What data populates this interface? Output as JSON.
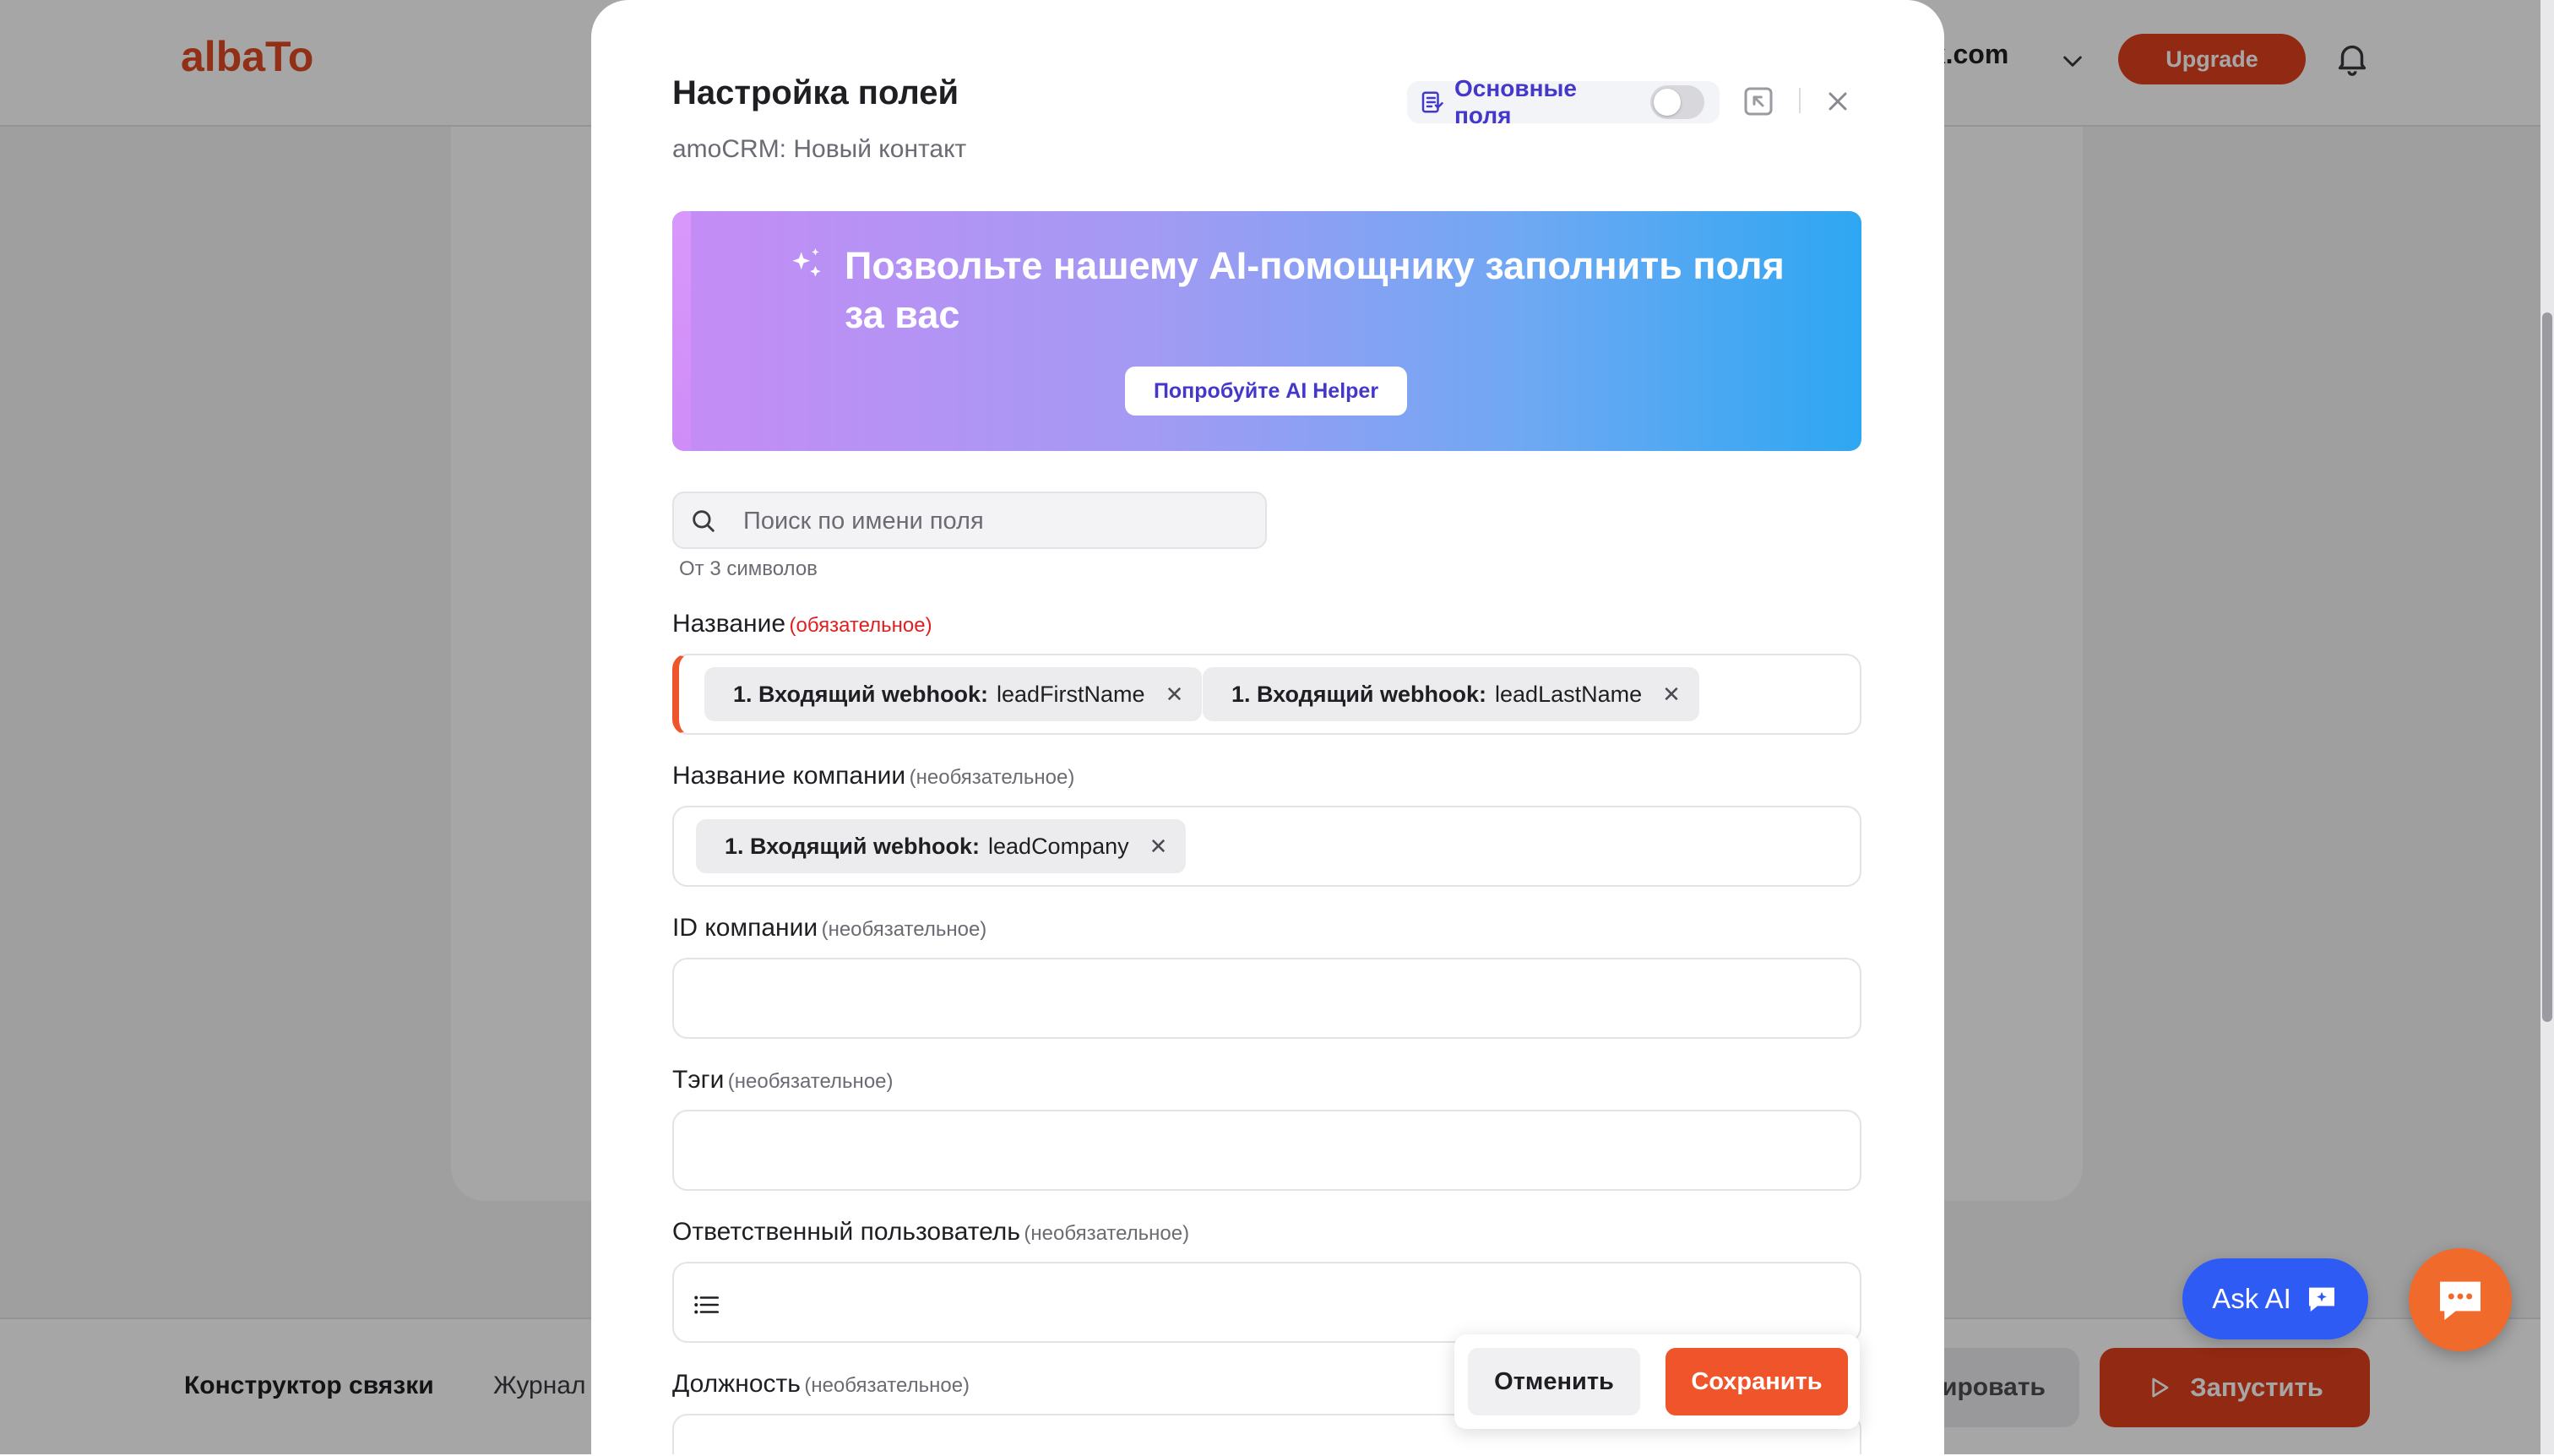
{
  "app": {
    "logo": "albaTo",
    "account": "vk.com",
    "upgrade_label": "Upgrade"
  },
  "bottom": {
    "tab_builder": "Конструктор связки",
    "tab_journal": "Журнал",
    "edit_label": "ировать",
    "run_label": "Запустить"
  },
  "floating": {
    "ask_ai": "Ask AI"
  },
  "modal": {
    "title": "Настройка полей",
    "subtitle": "amoCRM: Новый контакт",
    "basic_fields_label": "Основные поля",
    "basic_fields_enabled": false,
    "banner_text": "Позвольте нашему AI-помощнику заполнить поля за вас",
    "banner_button": "Попробуйте AI Helper",
    "search_placeholder": "Поиск по имени поля",
    "search_hint": "От 3 символов",
    "fields": [
      {
        "label": "Название",
        "tag": "(обязательное)",
        "chips": [
          {
            "source": "1. Входящий webhook:",
            "value": "leadFirstName"
          },
          {
            "source": "1. Входящий webhook:",
            "value": "leadLastName"
          }
        ]
      },
      {
        "label": "Название компании",
        "tag": "(необязательное)",
        "chips": [
          {
            "source": "1. Входящий webhook:",
            "value": "leadCompany"
          }
        ]
      },
      {
        "label": "ID компании",
        "tag": "(необязательное)"
      },
      {
        "label": "Тэги",
        "tag": "(необязательное)"
      },
      {
        "label": "Ответственный пользователь",
        "tag": "(необязательное)"
      },
      {
        "label": "Должность",
        "tag": "(необязательное)"
      }
    ],
    "cancel_label": "Отменить",
    "save_label": "Сохранить"
  },
  "colors": {
    "brand": "#e04a24",
    "save": "#f0542a",
    "ask_ai": "#2f5bf5",
    "accent_text": "#4338ca"
  }
}
